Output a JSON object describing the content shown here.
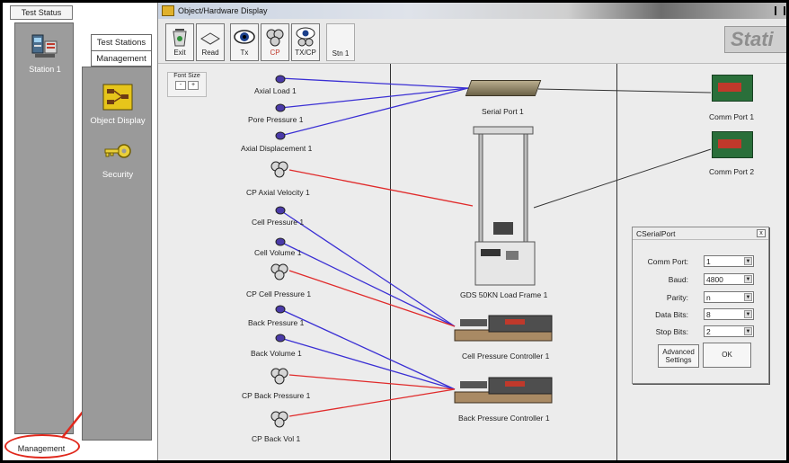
{
  "left_nav": {
    "top_tab": "Test Status",
    "station_label": "Station 1",
    "bottom_tab": "Management"
  },
  "mid_nav": {
    "header_line1": "Test Stations",
    "header_line2": "Management",
    "items": [
      {
        "label": "Object Display",
        "icon": "object-display-icon"
      },
      {
        "label": "Security",
        "icon": "key-icon"
      }
    ]
  },
  "window": {
    "title": "Object/Hardware Display",
    "brand_text": "Stati"
  },
  "toolbar": {
    "buttons": [
      {
        "label": "Exit",
        "icon": "recycle-bin-icon"
      },
      {
        "label": "Read",
        "icon": "book-icon"
      },
      {
        "label": "Tx",
        "icon": "eye-icon"
      },
      {
        "label": "CP",
        "icon": "controller-icon"
      },
      {
        "label": "TX/CP",
        "icon": "eye-controller-icon"
      }
    ],
    "station_button": "Stn 1"
  },
  "font_size": {
    "label": "Font Size",
    "minus": "-",
    "plus": "+"
  },
  "sensors": [
    "Axial Load 1",
    "Pore Pressure 1",
    "Axial Displacement 1",
    "CP Axial Velocity 1",
    "Cell Pressure 1",
    "Cell Volume 1",
    "CP Cell Pressure 1",
    "Back Pressure 1",
    "Back Volume 1",
    "CP Back Pressure 1",
    "CP Back Vol 1"
  ],
  "devices": {
    "serial_port": "Serial Port 1",
    "load_frame": "GDS 50KN Load Frame 1",
    "cell_controller": "Cell Pressure Controller 1",
    "back_controller": "Back Pressure Controller 1",
    "comm_port1": "Comm Port 1",
    "comm_port2": "Comm Port 2"
  },
  "dialog": {
    "title": "CSerialPort",
    "close": "x",
    "fields": [
      {
        "label": "Comm Port:",
        "value": "1"
      },
      {
        "label": "Baud:",
        "value": "4800"
      },
      {
        "label": "Parity:",
        "value": "n"
      },
      {
        "label": "Data Bits:",
        "value": "8"
      },
      {
        "label": "Stop Bits:",
        "value": "2"
      }
    ],
    "advanced_line1": "Advanced",
    "advanced_line2": "Settings",
    "ok": "OK"
  },
  "colors": {
    "sensor_link": "#3a2fd4",
    "cp_link": "#e02a2a",
    "annotation": "#e0281c"
  }
}
